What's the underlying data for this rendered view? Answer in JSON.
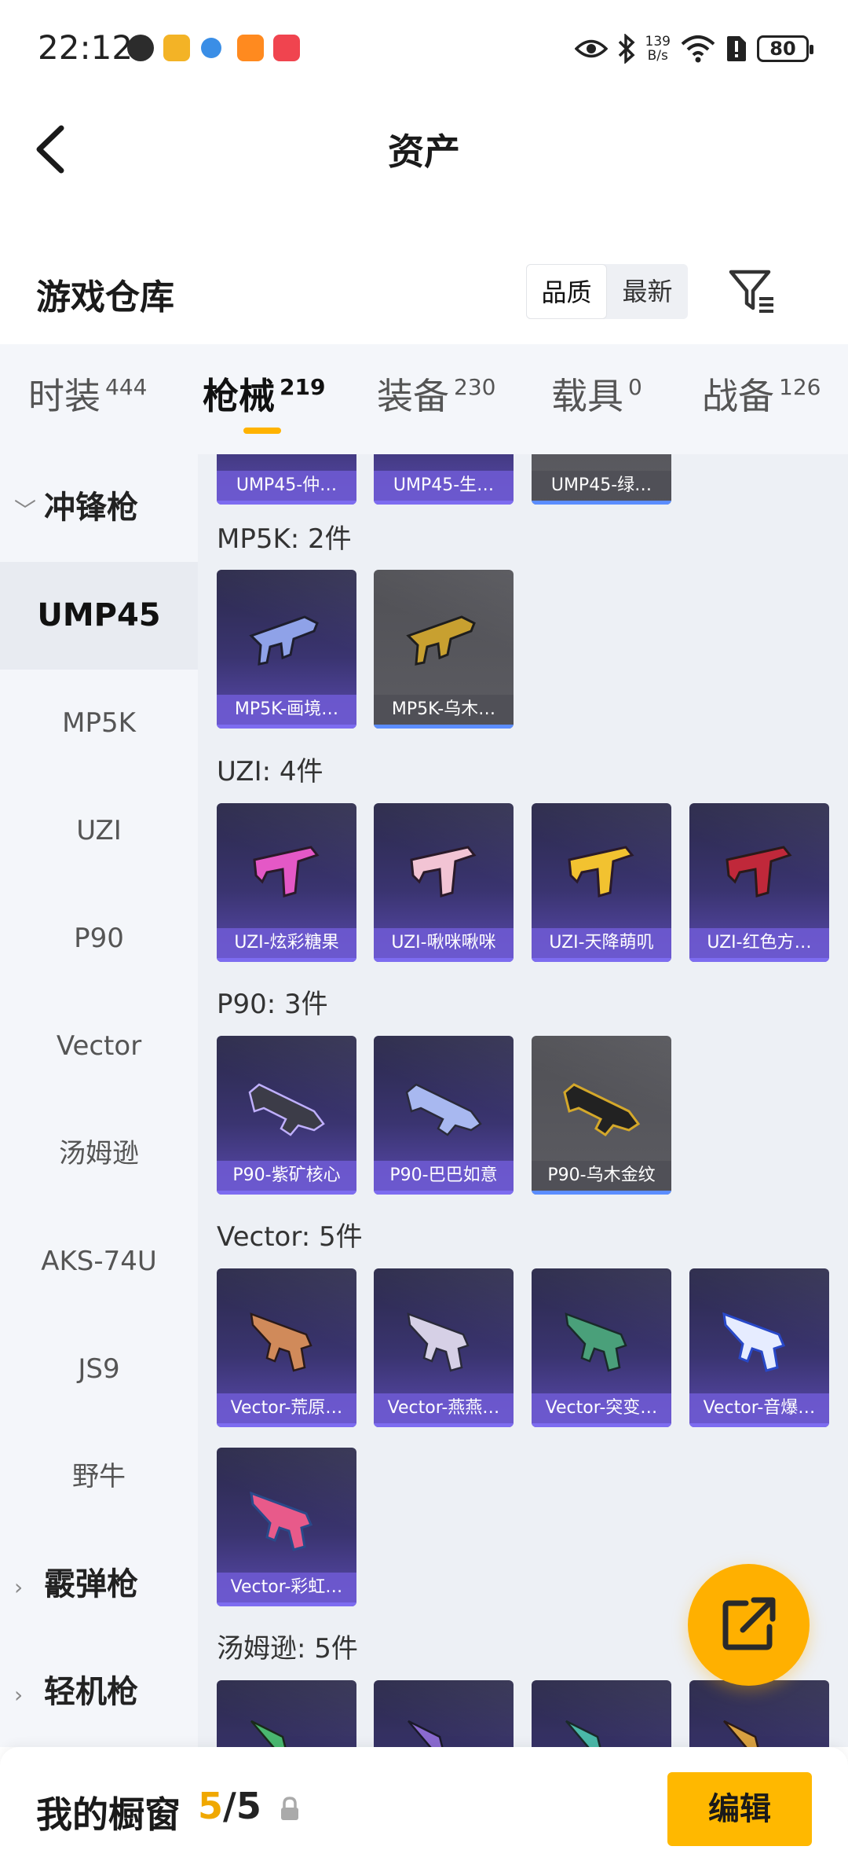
{
  "status_bar": {
    "time": "22:12",
    "net_speed_value": "139",
    "net_speed_unit": "B/s",
    "battery": "80"
  },
  "header": {
    "title": "资产"
  },
  "warehouse": {
    "title": "游戏仓库",
    "sort_options": [
      "品质",
      "最新"
    ],
    "active_sort": "品质"
  },
  "category_tabs": [
    {
      "label": "时装",
      "count": "444"
    },
    {
      "label": "枪械",
      "count": "219"
    },
    {
      "label": "装备",
      "count": "230"
    },
    {
      "label": "载具",
      "count": "0"
    },
    {
      "label": "战备",
      "count": "126"
    }
  ],
  "sidebar": {
    "groups": [
      "冲锋枪",
      "霰弹枪",
      "轻机枪"
    ],
    "items": [
      "UMP45",
      "MP5K",
      "UZI",
      "P90",
      "Vector",
      "汤姆逊",
      "AKS-74U",
      "JS9",
      "野牛"
    ],
    "active": "UMP45"
  },
  "sections": [
    {
      "title": "",
      "cards": [
        "UMP45-仲…",
        "UMP45-生…",
        "UMP45-绿…"
      ]
    },
    {
      "title": "MP5K: 2件",
      "cards": [
        "MP5K-画境…",
        "MP5K-乌木…"
      ]
    },
    {
      "title": "UZI: 4件",
      "cards": [
        "UZI-炫彩糖果",
        "UZI-啾咪啾咪",
        "UZI-天降萌叽",
        "UZI-红色方…"
      ]
    },
    {
      "title": "P90: 3件",
      "cards": [
        "P90-紫矿核心",
        "P90-巴巴如意",
        "P90-乌木金纹"
      ]
    },
    {
      "title": "Vector: 5件",
      "cards": [
        "Vector-荒原…",
        "Vector-燕燕…",
        "Vector-突变…",
        "Vector-音爆…",
        "Vector-彩虹…"
      ]
    },
    {
      "title": "汤姆逊: 5件",
      "cards": []
    }
  ],
  "showcase": {
    "title": "我的橱窗",
    "current": "5",
    "separator": "/",
    "total": "5",
    "edit_label": "编辑"
  },
  "colors": {
    "accent": "#ffb300",
    "card_purple": "#5a4ab0",
    "card_grey": "#5c5c62"
  }
}
